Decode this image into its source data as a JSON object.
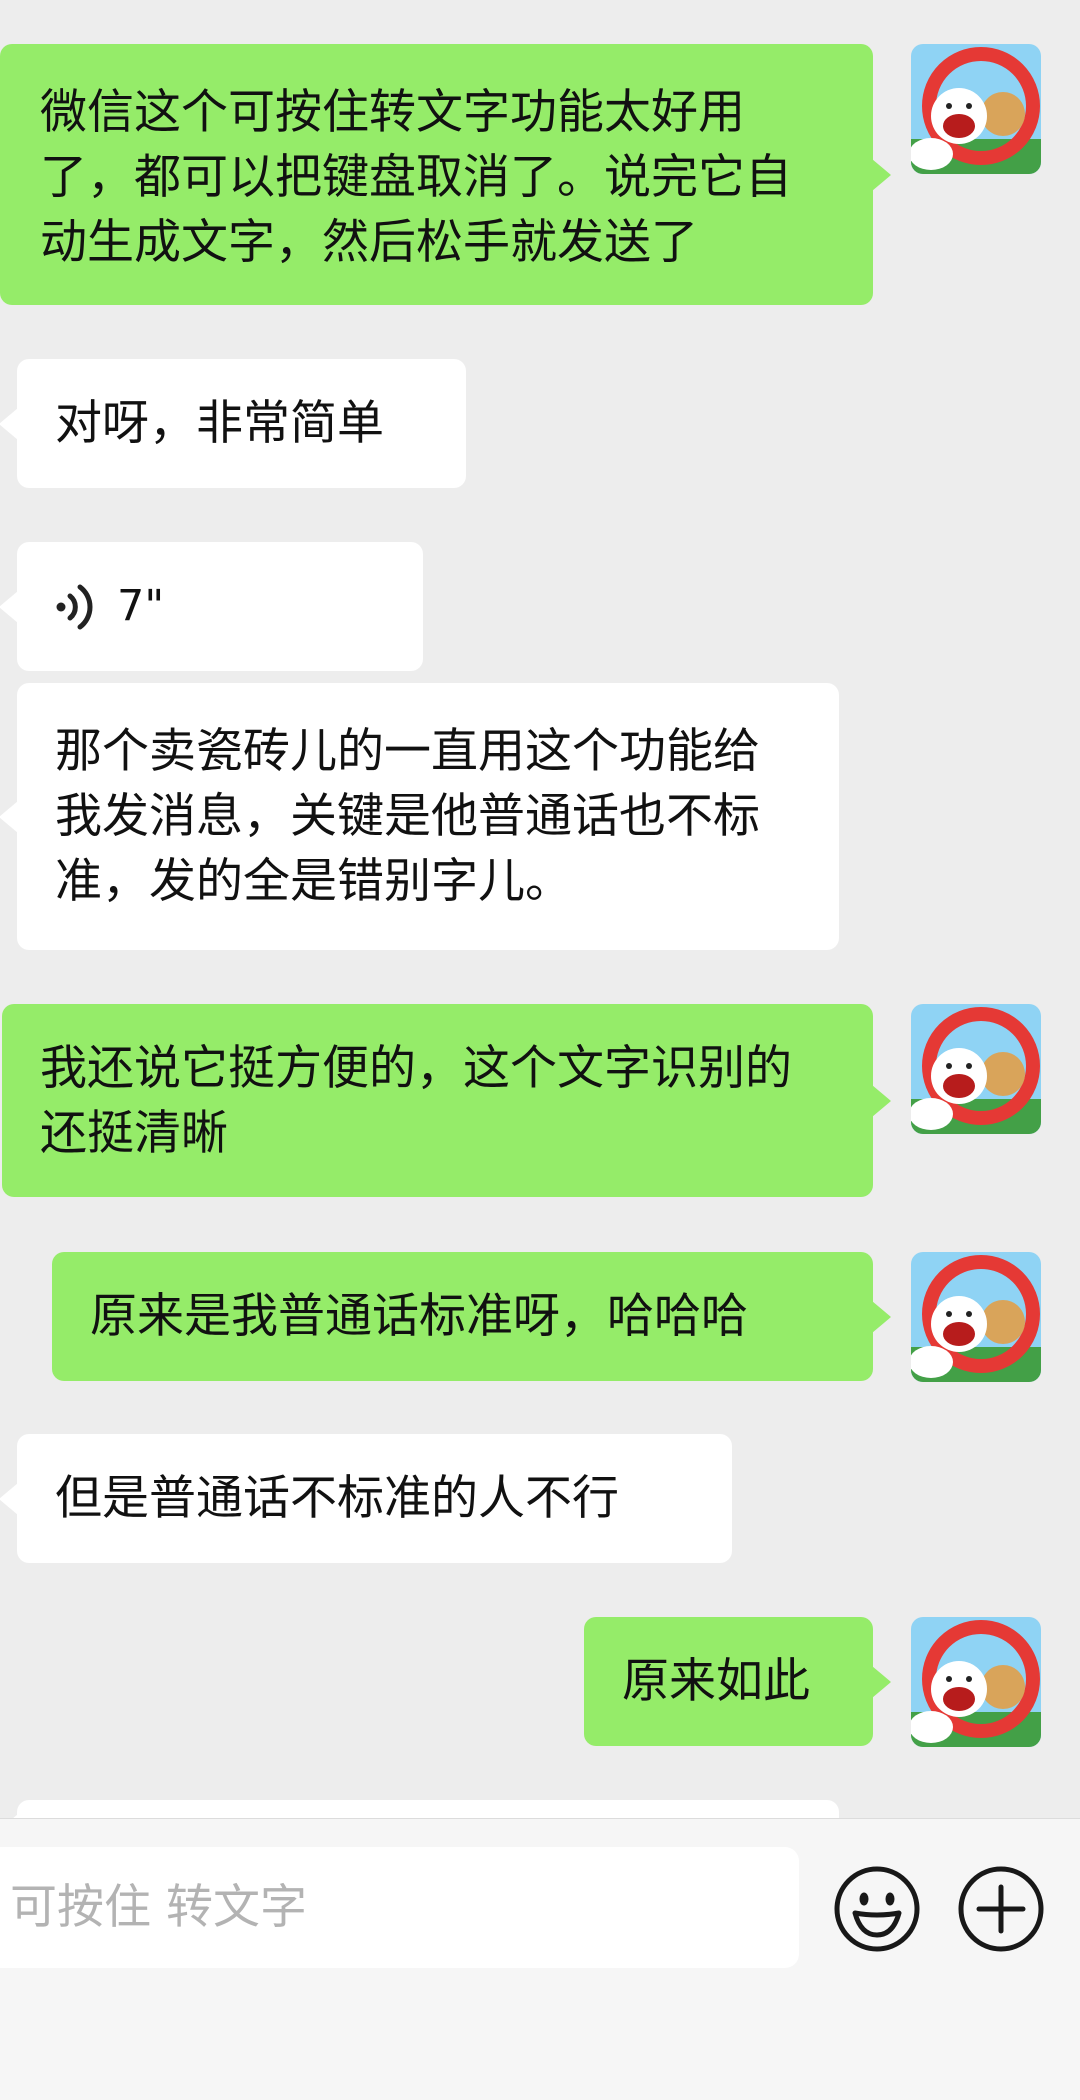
{
  "messages": [
    {
      "side": "me",
      "text": "微信这个可按住转文字功能太好用了，都可以把键盘取消了。说完它自动生成文字，然后松手就发送了"
    },
    {
      "side": "other",
      "text": "对呀，非常简单"
    },
    {
      "side": "other",
      "type": "voice",
      "duration": "7\""
    },
    {
      "side": "other",
      "text": "那个卖瓷砖儿的一直用这个功能给我发消息，关键是他普通话也不标准，发的全是错别字儿。"
    },
    {
      "side": "me",
      "text": "我还说它挺方便的，这个文字识别的还挺清晰"
    },
    {
      "side": "me",
      "text": "原来是我普通话标准呀，哈哈哈"
    },
    {
      "side": "other",
      "text": "但是普通话不标准的人不行"
    },
    {
      "side": "me",
      "text": "原来如此"
    }
  ],
  "input": {
    "placeholder": "可按住 转文字"
  },
  "icons": {
    "emoji": "emoji-icon",
    "plus": "plus-icon",
    "voice": "voice-wave-icon"
  },
  "colors": {
    "background": "#ededed",
    "my_bubble": "#95ec69",
    "other_bubble": "#ffffff",
    "input_bar": "#f6f6f6"
  }
}
